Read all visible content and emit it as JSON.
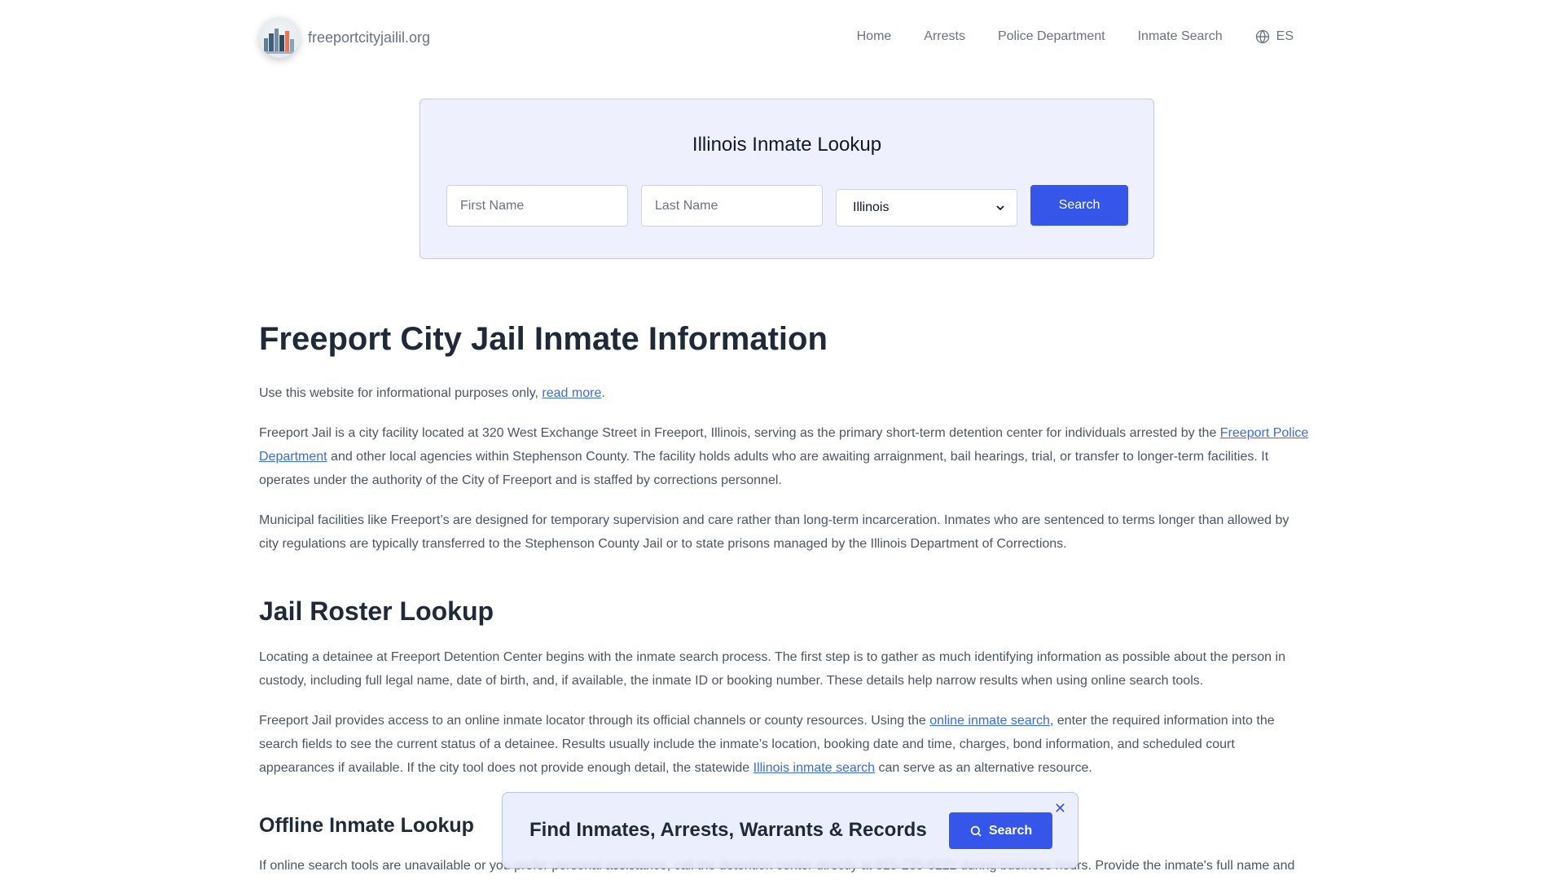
{
  "header": {
    "site_name": "freeportcityjailil.org",
    "nav": [
      "Home",
      "Arrests",
      "Police Department",
      "Inmate Search"
    ],
    "language": "ES"
  },
  "lookup": {
    "title": "Illinois Inmate Lookup",
    "first_name_placeholder": "First Name",
    "last_name_placeholder": "Last Name",
    "state_selected": "Illinois",
    "search_label": "Search"
  },
  "article": {
    "title": "Freeport City Jail Inmate Information",
    "intro": {
      "text": "Use this website for informational purposes only, ",
      "link": "read more",
      "after": "."
    },
    "p1": {
      "before": "Freeport Jail is a city facility located at 320 West Exchange Street in Freeport, Illinois, serving as the primary short-term detention center for individuals arrested by the ",
      "link": "Freeport Police Department",
      "after": " and other local agencies within Stephenson County. The facility holds adults who are awaiting arraignment, bail hearings, trial, or transfer to longer-term facilities. It operates under the authority of the City of Freeport and is staffed by corrections personnel."
    },
    "p2": "Municipal facilities like Freeport’s are designed for temporary supervision and care rather than long-term incarceration. Inmates who are sentenced to terms longer than allowed by city regulations are typically transferred to the Stephenson County Jail or to state prisons managed by the Illinois Department of Corrections.",
    "section1_title": "Jail Roster Lookup",
    "p3": "Locating a detainee at Freeport Detention Center begins with the inmate search process. The first step is to gather as much identifying information as possible about the person in custody, including full legal name, date of birth, and, if available, the inmate ID or booking number. These details help narrow results when using online search tools.",
    "p4": {
      "before": "Freeport Jail provides access to an online inmate locator through its official channels or county resources. Using the ",
      "link1": "online inmate search",
      "middle": ", enter the required information into the search fields to see the current status of a detainee. Results usually include the inmate’s location, booking date and time, charges, bond information, and scheduled court appearances if available. If the city tool does not provide enough detail, the statewide ",
      "link2": "Illinois inmate search",
      "after": " can serve as an alternative resource."
    },
    "section2_title": "Offline Inmate Lookup",
    "p5": "If online search tools are unavailable or you prefer personal assistance, call the detention center directly at 815-235-8222 during business hours. Provide the inmate's full name and date of birth to staff so they can verify custody status. For in-person inquiries, visit the facility’s reception area at 320 West Exchange Street, Freeport, IL 61032. Bring a government-"
  },
  "promo": {
    "title": "Find Inmates, Arrests, Warrants & Records",
    "button_label": "Search",
    "close_symbol": "✕"
  },
  "colors": {
    "accent": "#3656ea",
    "link": "#3b6ae8",
    "card_bg": "#eef0fd"
  }
}
